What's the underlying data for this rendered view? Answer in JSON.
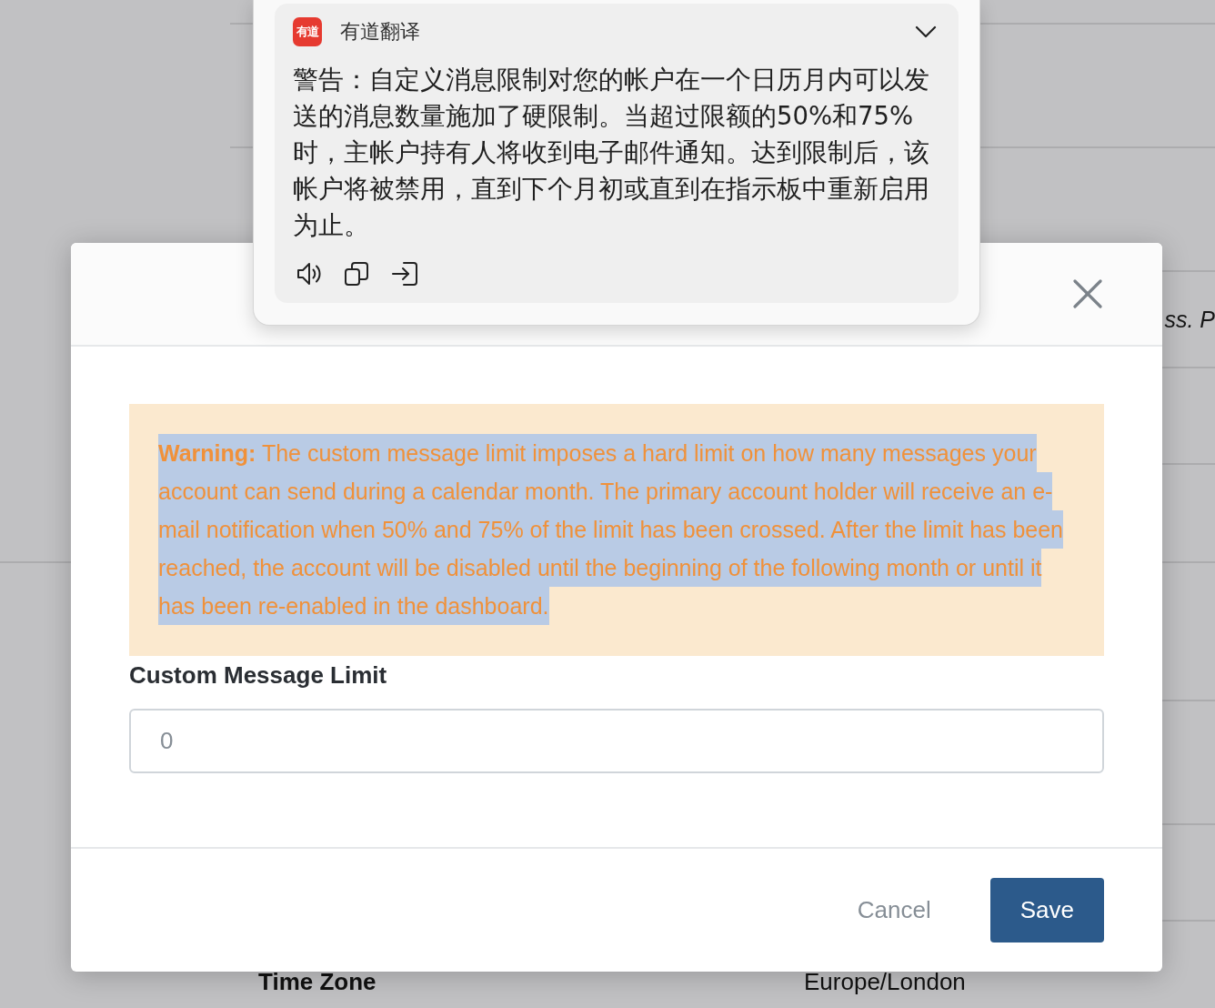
{
  "background": {
    "note_fragment": "ss. P",
    "setting_row": {
      "label": "Time Zone",
      "value": "Europe/London"
    }
  },
  "modal": {
    "warning": {
      "text": "**Warning:** The custom message limit imposes a hard limit on how many messages your account can send during a calendar month. The primary account holder will receive an e-mail notification when 50% and 75% of the limit has been crossed. After the limit has been reached, the account will be disabled until the beginning of the following month or until it has been re-enabled in the dashboard.",
      "highlighted": true
    },
    "field": {
      "label": "Custom Message Limit",
      "placeholder": "0"
    },
    "buttons": [
      {
        "label": "Cancel",
        "kind": "secondary"
      },
      {
        "label": "Save",
        "kind": "primary"
      }
    ]
  },
  "translation_popup": {
    "logo": "有道",
    "title": "有道翻译",
    "text": "警告：自定义消息限制对您的帐户在一个日历月内可以发送的消息数量施加了硬限制。当超过限额的50%和75%时，主帐户持有人将收到电子邮件通知。达到限制后，该帐户将被禁用，直到下个月初或直到在指示板中重新启用为止。"
  }
}
